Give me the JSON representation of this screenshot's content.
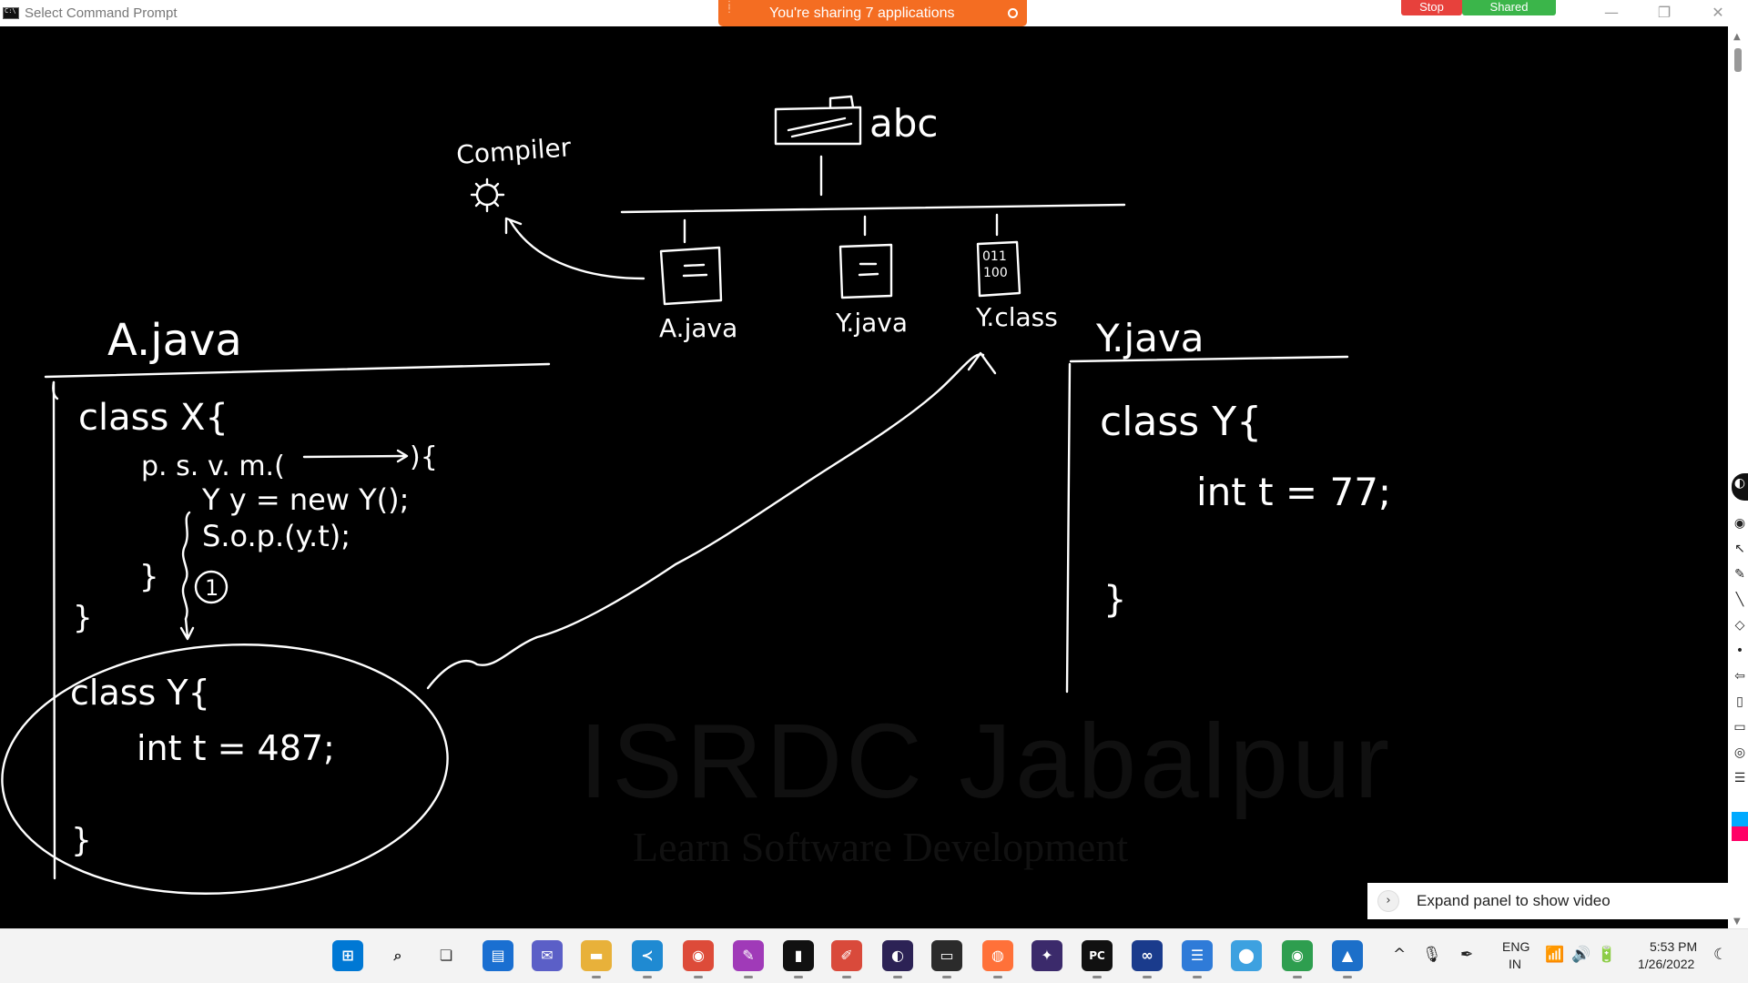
{
  "window": {
    "title": "Select Command Prompt",
    "minimize_glyph": "—",
    "maximize_glyph": "❐",
    "close_glyph": "✕"
  },
  "share_banner": {
    "text": "You're sharing 7 applications",
    "color": "#f46d22"
  },
  "session_controls": {
    "stop_label": "Stop",
    "shared_label": "Shared",
    "stop_color": "#e7413c",
    "shared_color": "#3bb54a"
  },
  "board": {
    "labels": {
      "abc": "abc",
      "compiler": "Compiler",
      "tree_a_java": "A.java",
      "tree_y_java": "Y.java",
      "tree_y_class": "Y.class",
      "class_file_bits_1": "011",
      "class_file_bits_2": "100",
      "circled_number": "1"
    },
    "left_panel": {
      "heading": "A.java",
      "lines": [
        "class  X{",
        "p. s. v. m.(",
        "){",
        "Y y = new Y();",
        "S.o.p.(y.t);",
        "}",
        "}",
        "class  Y{",
        "int  t = 487;",
        "}"
      ]
    },
    "right_panel": {
      "heading": "Y.java",
      "lines": [
        "class  Y{",
        "int  t = 77;",
        "}"
      ]
    },
    "watermark": {
      "title": "ISRDC Jabalpur",
      "subtitle": "Learn Software Development"
    }
  },
  "expand_panel": {
    "label": "Expand panel to show video",
    "chevron": "›"
  },
  "taskbar": {
    "apps": [
      {
        "name": "windows-start",
        "glyph": "⊞",
        "color": "#0078d4"
      },
      {
        "name": "search",
        "glyph": "⌕",
        "color": "#222222"
      },
      {
        "name": "task-view",
        "glyph": "❏",
        "color": "#333333"
      },
      {
        "name": "widgets",
        "glyph": "▤",
        "color": "#1a6fd1"
      },
      {
        "name": "teams-chat",
        "glyph": "✉",
        "color": "#5b5fc7"
      },
      {
        "name": "file-explorer",
        "glyph": "▬",
        "color": "#e8b13a"
      },
      {
        "name": "vs-code",
        "glyph": "≺",
        "color": "#1f8ad2"
      },
      {
        "name": "chrome-ai",
        "glyph": "◉",
        "color": "#dd4b39"
      },
      {
        "name": "paint-brush",
        "glyph": "✎",
        "color": "#a03ab8"
      },
      {
        "name": "terminal",
        "glyph": "▮",
        "color": "#111111"
      },
      {
        "name": "pen-app",
        "glyph": "✐",
        "color": "#d94a3b"
      },
      {
        "name": "eclipse",
        "glyph": "◐",
        "color": "#2c2255"
      },
      {
        "name": "mysql-console",
        "glyph": "▭",
        "color": "#2b2b2b"
      },
      {
        "name": "firefox",
        "glyph": "◍",
        "color": "#ff7139"
      },
      {
        "name": "feather-app",
        "glyph": "✦",
        "color": "#3b2a6b"
      },
      {
        "name": "pycharm",
        "glyph": "PC",
        "color": "#111111"
      },
      {
        "name": "loop-app",
        "glyph": "∞",
        "color": "#1a3b8c"
      },
      {
        "name": "notepad",
        "glyph": "☰",
        "color": "#2f7bd8"
      },
      {
        "name": "maps",
        "glyph": "⬤",
        "color": "#3da1e0"
      },
      {
        "name": "chrome-profile",
        "glyph": "◉",
        "color": "#2e9e4f"
      },
      {
        "name": "photos",
        "glyph": "▲",
        "color": "#1c6fc9"
      }
    ],
    "tray": {
      "chevron": "^",
      "mic": "🎙",
      "pen": "✒",
      "lang_top": "ENG",
      "lang_bottom": "IN",
      "wifi": "📶",
      "volume": "🔊",
      "battery": "🔋",
      "time": "5:53 PM",
      "date": "1/26/2022",
      "moon": "☾"
    }
  }
}
